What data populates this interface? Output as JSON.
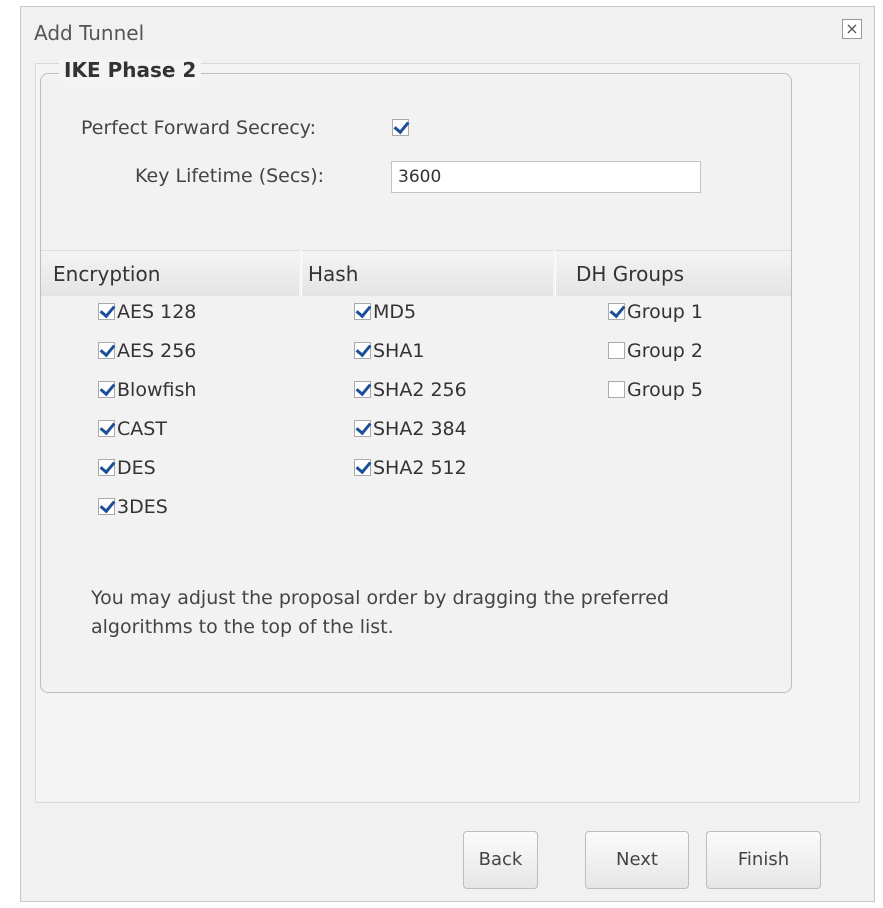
{
  "dialog": {
    "title": "Add Tunnel",
    "close_symbol": "×"
  },
  "phase2": {
    "legend": "IKE Phase 2",
    "pfs_label": "Perfect Forward Secrecy:",
    "pfs_checked": true,
    "lifetime_label": "Key Lifetime (Secs):",
    "lifetime_value": "3600"
  },
  "columns": {
    "encryption": {
      "header": "Encryption",
      "items": [
        {
          "label": "AES 128",
          "checked": true
        },
        {
          "label": "AES 256",
          "checked": true
        },
        {
          "label": "Blowfish",
          "checked": true
        },
        {
          "label": "CAST",
          "checked": true
        },
        {
          "label": "DES",
          "checked": true
        },
        {
          "label": "3DES",
          "checked": true
        }
      ]
    },
    "hash": {
      "header": "Hash",
      "items": [
        {
          "label": "MD5",
          "checked": true
        },
        {
          "label": "SHA1",
          "checked": true
        },
        {
          "label": "SHA2 256",
          "checked": true
        },
        {
          "label": "SHA2 384",
          "checked": true
        },
        {
          "label": "SHA2 512",
          "checked": true
        }
      ]
    },
    "dh": {
      "header": "DH Groups",
      "items": [
        {
          "label": "Group 1",
          "checked": true
        },
        {
          "label": "Group 2",
          "checked": false
        },
        {
          "label": "Group 5",
          "checked": false
        }
      ]
    }
  },
  "note": "You may adjust the proposal order by dragging the preferred algorithms to the top of the list.",
  "buttons": {
    "back": "Back",
    "next": "Next",
    "finish": "Finish"
  }
}
